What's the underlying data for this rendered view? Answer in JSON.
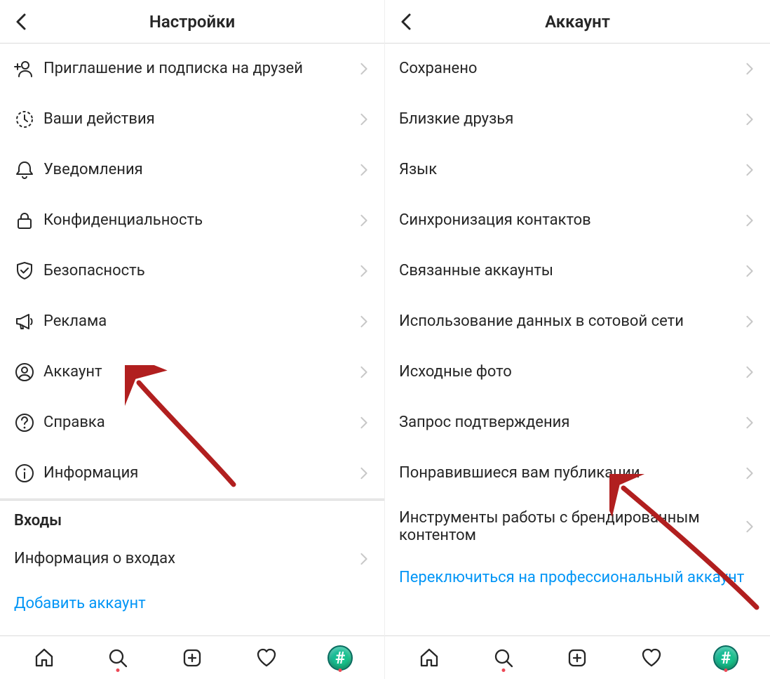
{
  "left": {
    "title": "Настройки",
    "items": [
      {
        "id": "invite-follow",
        "label": "Приглашение и подписка на друзей",
        "icon": "invite-person-icon"
      },
      {
        "id": "your-activity",
        "label": "Ваши действия",
        "icon": "activity-clock-icon"
      },
      {
        "id": "notifications",
        "label": "Уведомления",
        "icon": "bell-icon"
      },
      {
        "id": "privacy",
        "label": "Конфиденциальность",
        "icon": "lock-icon"
      },
      {
        "id": "security",
        "label": "Безопасность",
        "icon": "shield-check-icon"
      },
      {
        "id": "ads",
        "label": "Реклама",
        "icon": "megaphone-icon"
      },
      {
        "id": "account",
        "label": "Аккаунт",
        "icon": "person-circle-icon"
      },
      {
        "id": "help",
        "label": "Справка",
        "icon": "help-circle-icon"
      },
      {
        "id": "about",
        "label": "Информация",
        "icon": "info-circle-icon"
      }
    ],
    "logins_section_title": "Входы",
    "login_info_label": "Информация о входах",
    "add_account_label": "Добавить аккаунт"
  },
  "right": {
    "title": "Аккаунт",
    "items": [
      {
        "id": "saved",
        "label": "Сохранено"
      },
      {
        "id": "close-friends",
        "label": "Близкие друзья"
      },
      {
        "id": "language",
        "label": "Язык"
      },
      {
        "id": "contacts-sync",
        "label": "Синхронизация контактов"
      },
      {
        "id": "linked-accounts",
        "label": "Связанные аккаунты"
      },
      {
        "id": "cellular-data",
        "label": "Использование данных в сотовой сети"
      },
      {
        "id": "original-photos",
        "label": "Исходные фото"
      },
      {
        "id": "request-verification",
        "label": "Запрос подтверждения"
      },
      {
        "id": "liked-posts",
        "label": "Понравившиеся вам публикации"
      },
      {
        "id": "branded-content",
        "label": "Инструменты работы с брендированным контентом"
      }
    ],
    "switch_account_label": "Переключиться на профессиональный аккаунт"
  }
}
